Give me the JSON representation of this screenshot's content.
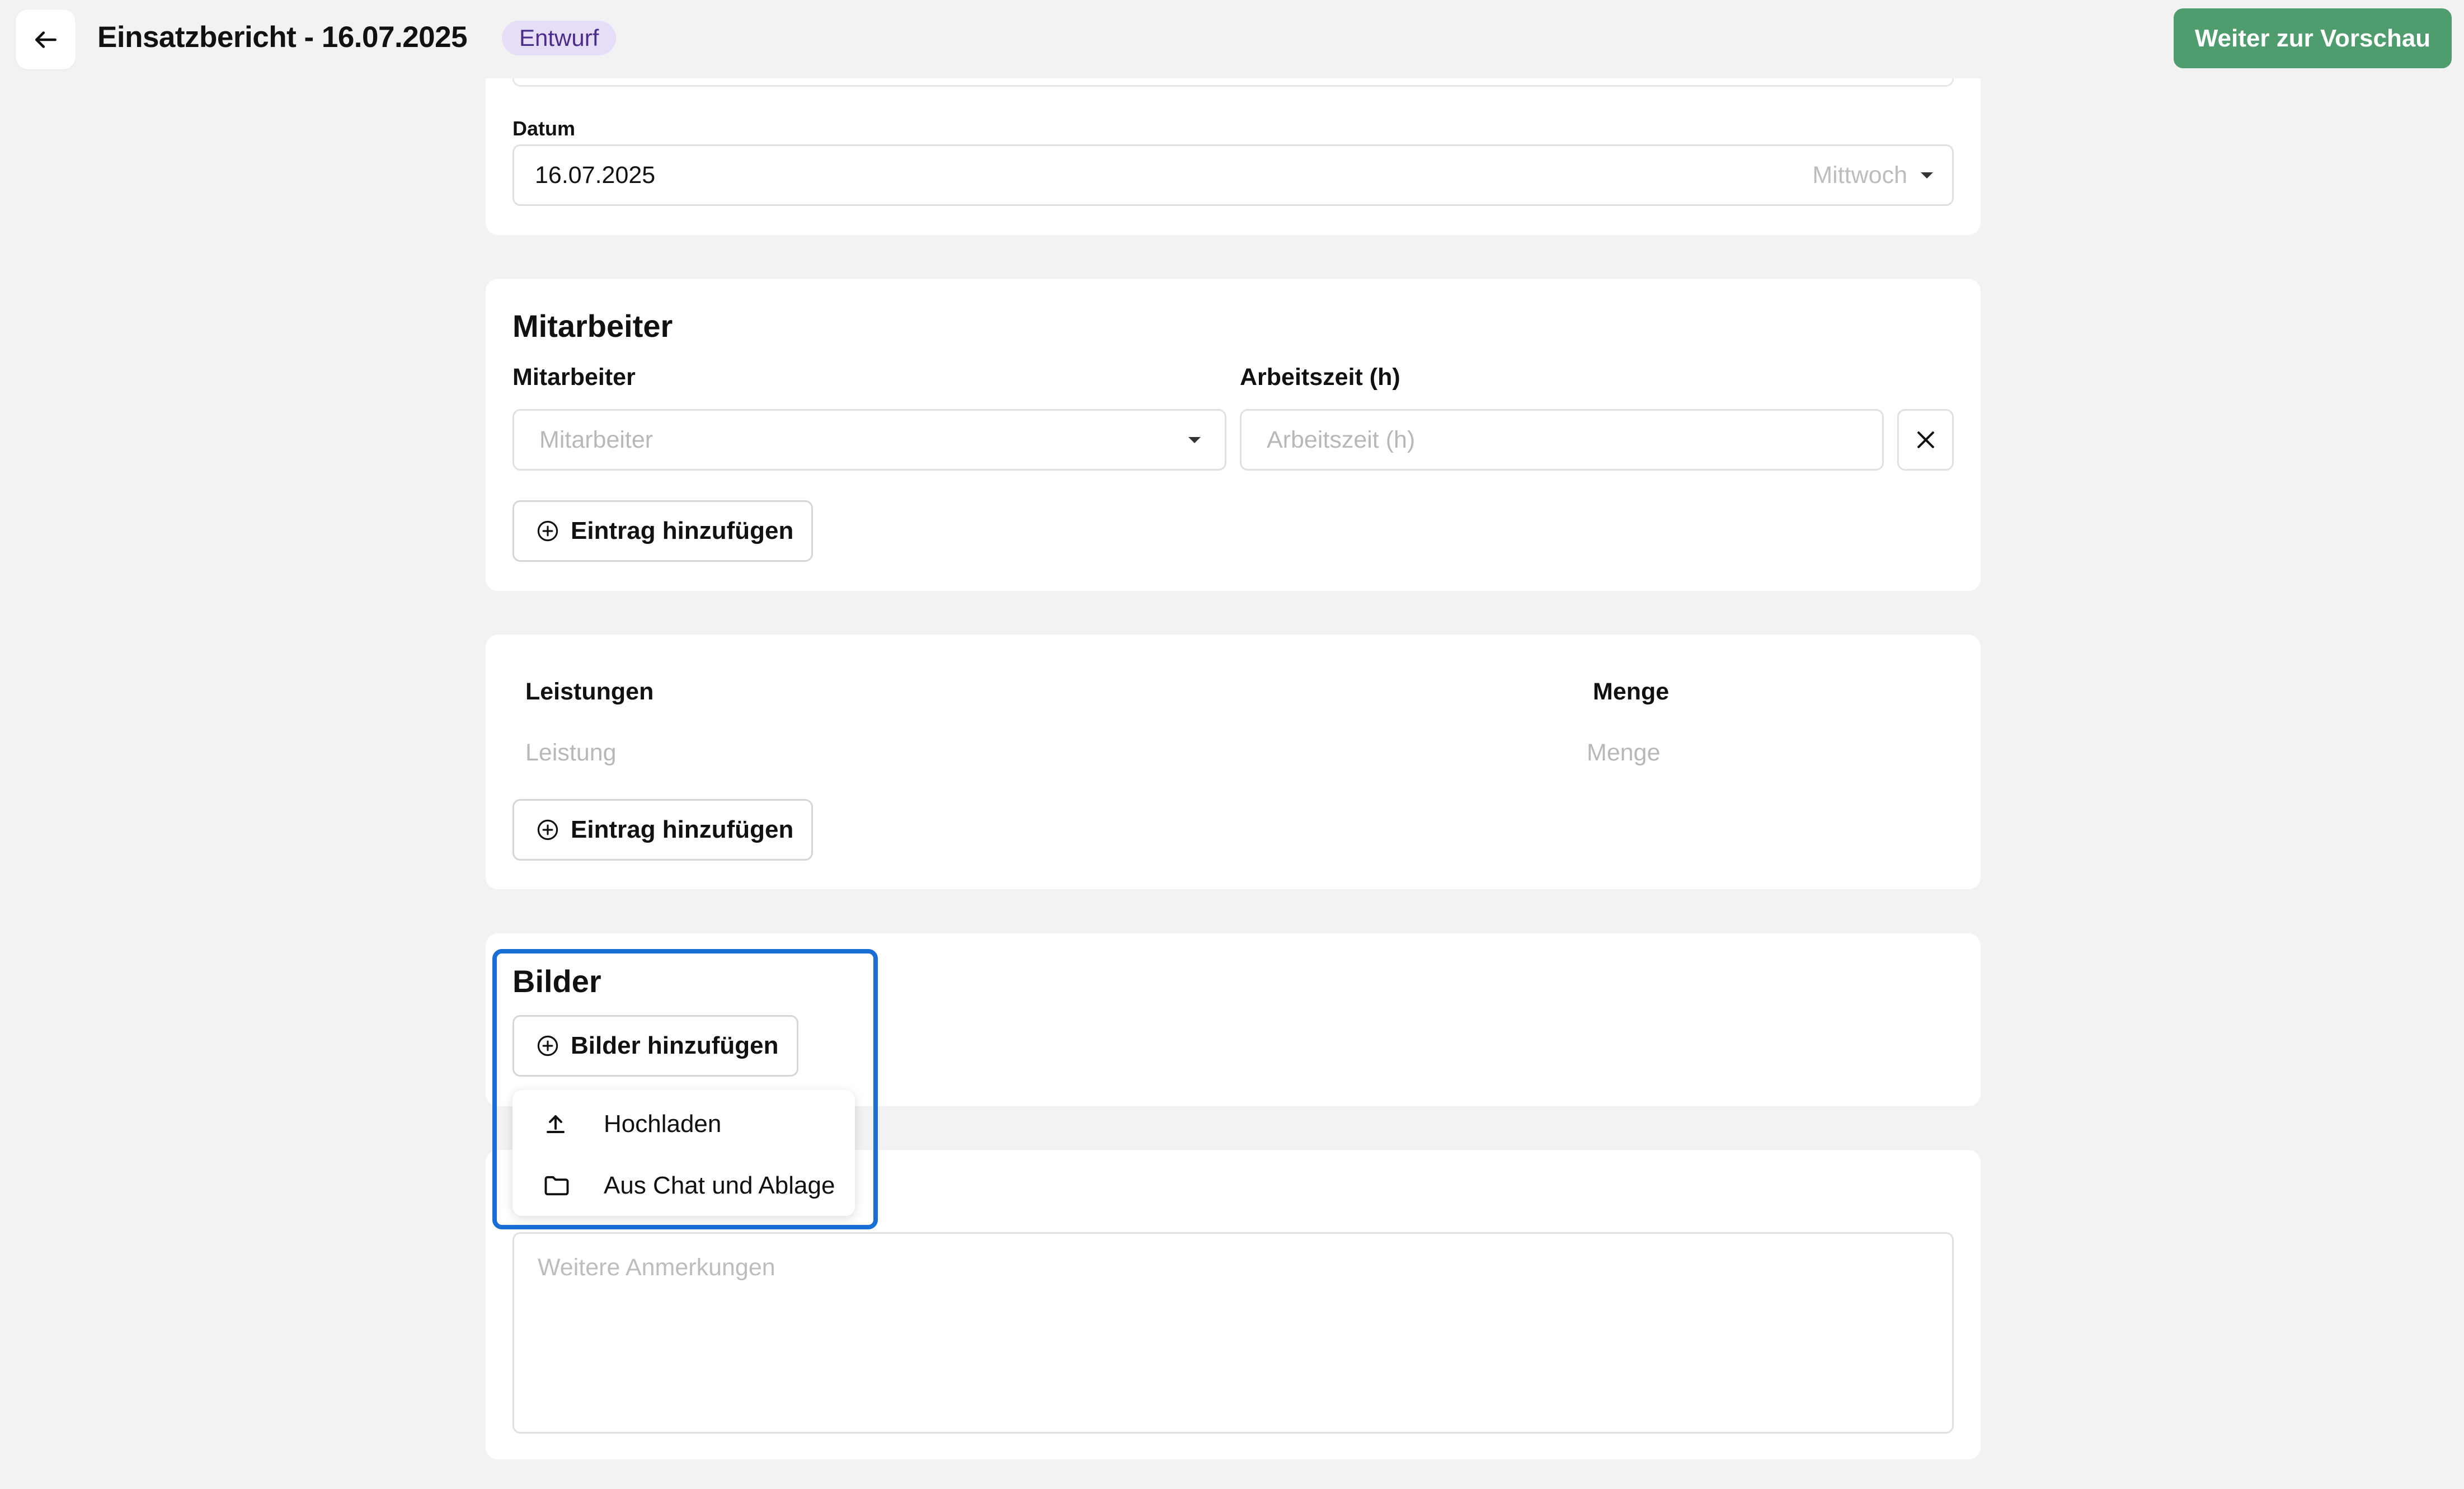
{
  "header": {
    "title": "Einsatzbericht - 16.07.2025",
    "status_badge": "Entwurf",
    "preview_button": "Weiter zur Vorschau"
  },
  "date_section": {
    "label": "Datum",
    "value": "16.07.2025",
    "weekday": "Mittwoch"
  },
  "employees_section": {
    "title": "Mitarbeiter",
    "employee_label": "Mitarbeiter",
    "employee_placeholder": "Mitarbeiter",
    "hours_label": "Arbeitszeit (h)",
    "hours_placeholder": "Arbeitszeit (h)",
    "add_button": "Eintrag hinzufügen"
  },
  "services_section": {
    "service_label": "Leistungen",
    "quantity_label": "Menge",
    "service_placeholder": "Leistung",
    "quantity_placeholder": "Menge",
    "add_button": "Eintrag hinzufügen"
  },
  "images_section": {
    "title": "Bilder",
    "add_button": "Bilder hinzufügen",
    "menu": [
      {
        "label": "Hochladen",
        "icon": "upload-icon"
      },
      {
        "label": "Aus Chat und Ablage",
        "icon": "folder-icon"
      }
    ]
  },
  "notes_section": {
    "placeholder": "Weitere Anmerkungen"
  },
  "colors": {
    "accent_green": "#4f9d6e",
    "badge_bg": "#e6ddf7",
    "highlight_blue": "#1a6fd6"
  }
}
